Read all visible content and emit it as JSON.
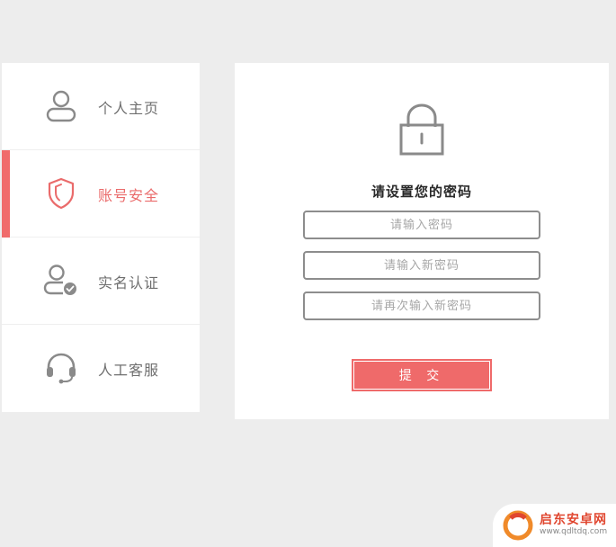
{
  "sidebar": {
    "items": [
      {
        "label": "个人主页",
        "icon": "user-icon",
        "active": false
      },
      {
        "label": "账号安全",
        "icon": "shield-icon",
        "active": true
      },
      {
        "label": "实名认证",
        "icon": "verified-user-icon",
        "active": false
      },
      {
        "label": "人工客服",
        "icon": "headset-icon",
        "active": false
      }
    ]
  },
  "panel": {
    "icon": "lock-icon",
    "title": "请设置您的密码",
    "fields": [
      {
        "placeholder": "请输入密码",
        "value": ""
      },
      {
        "placeholder": "请输入新密码",
        "value": ""
      },
      {
        "placeholder": "请再次输入新密码",
        "value": ""
      }
    ],
    "submit_label": "提 交"
  },
  "watermark": {
    "name": "启东安卓网",
    "url": "www.qdltdq.com"
  },
  "colors": {
    "accent": "#f06b6b",
    "background": "#ededed",
    "icon_gray": "#8a8a8a",
    "text_gray": "#6f6f6f"
  }
}
